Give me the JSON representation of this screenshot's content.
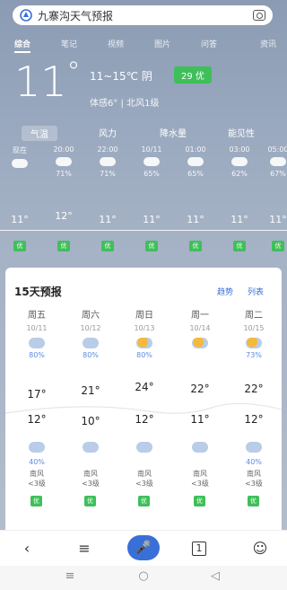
{
  "search": {
    "query": "九寨沟天气预报"
  },
  "tabs": [
    "综合",
    "笔记",
    "视频",
    "图片",
    "问答",
    "资讯"
  ],
  "current": {
    "temp": "11",
    "degree": "°",
    "range": "11~15℃ 阴",
    "aqi": "29 优",
    "feel": "体感6° | 北风1级"
  },
  "subtabs": [
    "气温",
    "风力",
    "降水量",
    "能见性"
  ],
  "hourly": [
    {
      "time": "现在",
      "pop": "",
      "temp": "11°"
    },
    {
      "time": "20:00",
      "pop": "71%",
      "temp": "12°"
    },
    {
      "time": "22:00",
      "pop": "71%",
      "temp": "11°"
    },
    {
      "time": "10/11",
      "pop": "65%",
      "temp": "11°"
    },
    {
      "time": "01:00",
      "pop": "65%",
      "temp": "11°"
    },
    {
      "time": "03:00",
      "pop": "62%",
      "temp": "11°"
    },
    {
      "time": "05:00",
      "pop": "67%",
      "temp": "11°"
    }
  ],
  "forecast": {
    "title": "15天预报",
    "links": [
      "趋势",
      "列表"
    ],
    "days": [
      {
        "week": "周五",
        "date": "10/11",
        "pop": "80%",
        "high": "17°",
        "low": "12°",
        "night_pop": "40%",
        "wind_dir": "南风",
        "wind_lvl": "<3级",
        "aqi": "优",
        "day_sun": false
      },
      {
        "week": "周六",
        "date": "10/12",
        "pop": "80%",
        "high": "21°",
        "low": "10°",
        "night_pop": "",
        "wind_dir": "南风",
        "wind_lvl": "<3级",
        "aqi": "优",
        "day_sun": false
      },
      {
        "week": "周日",
        "date": "10/13",
        "pop": "80%",
        "high": "24°",
        "low": "12°",
        "night_pop": "",
        "wind_dir": "南风",
        "wind_lvl": "<3级",
        "aqi": "优",
        "day_sun": true
      },
      {
        "week": "周一",
        "date": "10/14",
        "pop": "",
        "high": "22°",
        "low": "11°",
        "night_pop": "",
        "wind_dir": "南风",
        "wind_lvl": "<3级",
        "aqi": "优",
        "day_sun": true
      },
      {
        "week": "周二",
        "date": "10/15",
        "pop": "73%",
        "high": "22°",
        "low": "12°",
        "night_pop": "40%",
        "wind_dir": "南风",
        "wind_lvl": "<3级",
        "aqi": "优",
        "day_sun": true
      }
    ]
  },
  "toolbar": {
    "back": "‹",
    "menu": "≡",
    "mic": "🎤",
    "tab_count": "1",
    "profile": "☺"
  },
  "navbar": {
    "menu": "≡",
    "home": "○",
    "back": "◁"
  }
}
